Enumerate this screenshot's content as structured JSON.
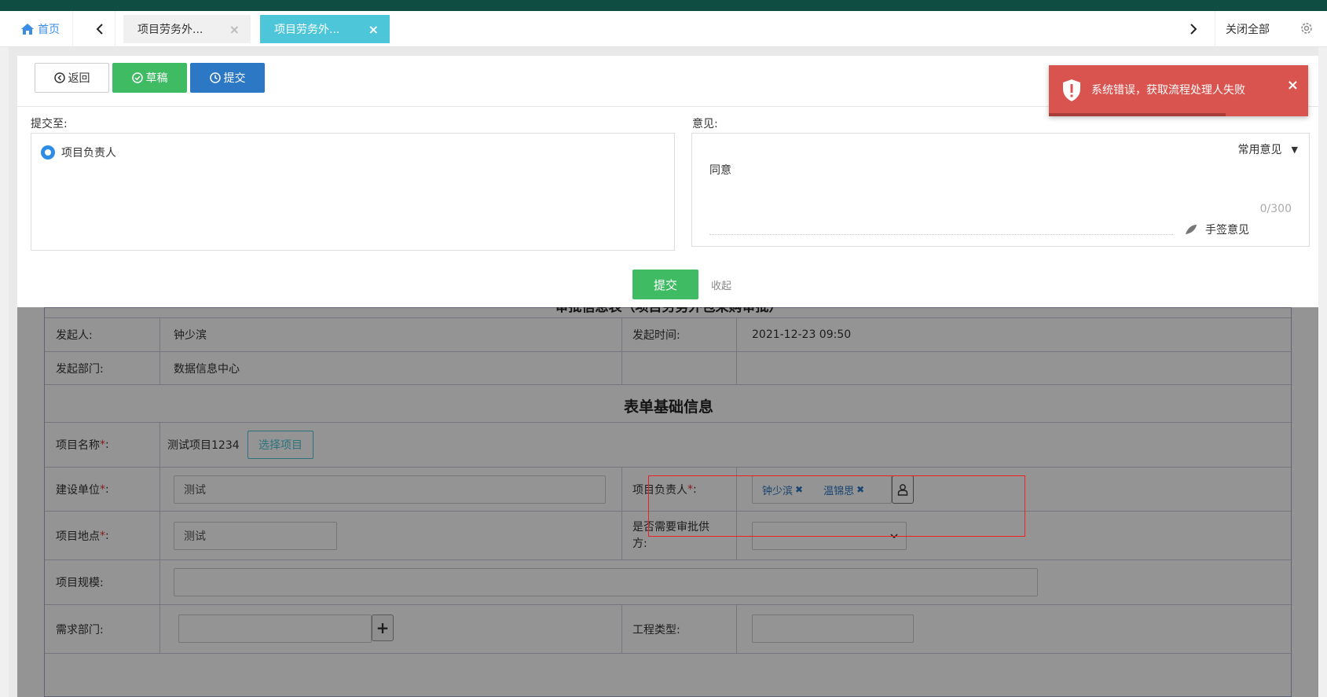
{
  "tabs": {
    "home_label": "首页",
    "items": [
      {
        "label": "项目劳务外..."
      },
      {
        "label": "项目劳务外..."
      }
    ],
    "close_all_label": "关闭全部"
  },
  "toolbar": {
    "back_label": "返回",
    "draft_label": "草稿",
    "submit_label": "提交"
  },
  "submit_panel": {
    "submit_to_label": "提交至:",
    "option_label": "项目负责人",
    "opinion_label": "意见:",
    "common_opinion_label": "常用意见",
    "opinion_text": "同意",
    "char_count": "0/300",
    "handsign_label": "手签意见",
    "submit_button_label": "提交",
    "collapse_label": "收起"
  },
  "toast": {
    "message": "系统错误，获取流程处理人失败",
    "close_symbol": "×"
  },
  "form": {
    "partial_title": "审批信息表（项目劳务外包采购审批）",
    "initiator_label": "发起人:",
    "initiator_value": "钟少滨",
    "initiated_time_label": "发起时间:",
    "initiated_time_value": "2021-12-23 09:50",
    "department_label": "发起部门:",
    "department_value": "数据信息中心",
    "section_title": "表单基础信息",
    "project_name_label": "项目名称",
    "project_name_value": "测试项目1234",
    "select_project_label": "选择项目",
    "construction_unit_label": "建设单位",
    "construction_unit_value": "测试",
    "project_lead_label": "项目负责人",
    "project_lead_tags": [
      "钟少滨",
      "温锦思"
    ],
    "project_location_label": "项目地点",
    "project_location_value": "测试",
    "need_approval_label_1": "是否需要审批供",
    "need_approval_label_2": "方:",
    "project_scale_label": "项目规模:",
    "demand_dept_label": "需求部门:",
    "engineering_type_label": "工程类型:",
    "required_mark": "*",
    "colon": ":"
  },
  "colors": {
    "top_strip": "#0f4d42",
    "active_tab": "#4cc6d8",
    "primary_blue": "#2d78c4",
    "green": "#3fbb64",
    "error_red": "#d9534f"
  }
}
